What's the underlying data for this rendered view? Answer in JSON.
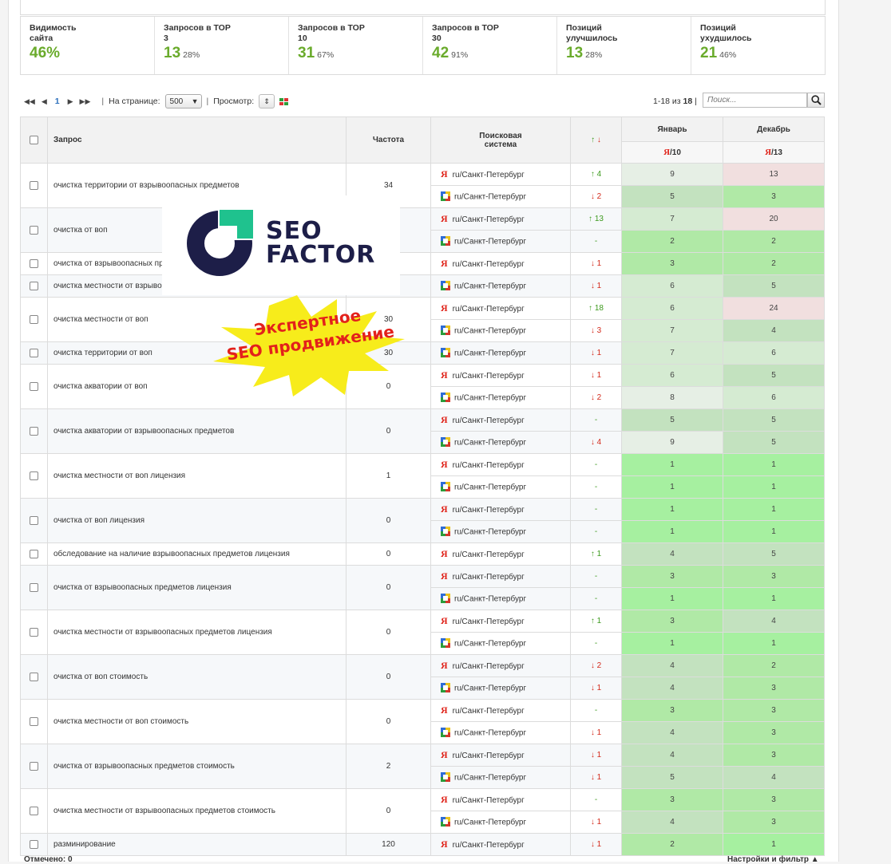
{
  "stats": [
    {
      "label": "Видимость сайта",
      "value": "46%",
      "pct": ""
    },
    {
      "label": "Запросов в TOP 3",
      "value": "13",
      "pct": "28%"
    },
    {
      "label": "Запросов в TOP 10",
      "value": "31",
      "pct": "67%"
    },
    {
      "label": "Запросов в TOP 30",
      "value": "42",
      "pct": "91%"
    },
    {
      "label": "Позиций улучшилось",
      "value": "13",
      "pct": "28%"
    },
    {
      "label": "Позиций ухудшилось",
      "value": "21",
      "pct": "46%"
    }
  ],
  "pager": {
    "first": "◀◀",
    "prev": "◀",
    "page": "1",
    "next": "▶",
    "last": "▶▶",
    "per_page_label": "На странице:",
    "per_page": "500",
    "view_label": "Просмотр:",
    "count_text": "1-18 из ",
    "count_total": "18",
    "search_placeholder": "Поиск..."
  },
  "table": {
    "headers": {
      "query": "Запрос",
      "freq": "Частота",
      "engine": "Поисковая система",
      "change": "↑↓",
      "jan": "Январь",
      "dec": "Декабрь",
      "jan_sub": "10",
      "dec_sub": "13"
    },
    "rows": [
      {
        "q": "очистка территории от взрывоопасных предметов",
        "f": "34",
        "e": [
          {
            "s": "y",
            "r": "ru/Санкт-Петербург",
            "c": "↑ 4",
            "ct": "up",
            "j": "9",
            "d": "13"
          },
          {
            "s": "g",
            "r": "ru/Санкт-Петербург",
            "c": "↓ 2",
            "ct": "dn",
            "j": "5",
            "d": "3"
          }
        ]
      },
      {
        "q": "очистка от воп",
        "f": "",
        "e": [
          {
            "s": "y",
            "r": "ru/Санкт-Петербург",
            "c": "↑ 13",
            "ct": "up",
            "j": "7",
            "d": "20"
          },
          {
            "s": "g",
            "r": "ru/Санкт-Петербург",
            "c": "-",
            "ct": "eq",
            "j": "2",
            "d": "2"
          }
        ]
      },
      {
        "q": "очистка от взрывоопасных пре",
        "f": "",
        "e": [
          {
            "s": "y",
            "r": "ru/Санкт-Петербург",
            "c": "↓ 1",
            "ct": "dn",
            "j": "3",
            "d": "2"
          }
        ]
      },
      {
        "q": "очистка местности от взрывоо",
        "f": "",
        "e": [
          {
            "s": "g",
            "r": "ru/Санкт-Петербург",
            "c": "↓ 1",
            "ct": "dn",
            "j": "6",
            "d": "5"
          }
        ]
      },
      {
        "q": "очистка местности от воп",
        "f": "30",
        "e": [
          {
            "s": "y",
            "r": "ru/Санкт-Петербург",
            "c": "↑ 18",
            "ct": "up",
            "j": "6",
            "d": "24"
          },
          {
            "s": "g",
            "r": "ru/Санкт-Петербург",
            "c": "↓ 3",
            "ct": "dn",
            "j": "7",
            "d": "4"
          }
        ]
      },
      {
        "q": "очистка территории от воп",
        "f": "30",
        "e": [
          {
            "s": "g",
            "r": "ru/Санкт-Петербург",
            "c": "↓ 1",
            "ct": "dn",
            "j": "7",
            "d": "6"
          }
        ]
      },
      {
        "q": "очистка акватории от воп",
        "f": "0",
        "e": [
          {
            "s": "y",
            "r": "ru/Санкт-Петербург",
            "c": "↓ 1",
            "ct": "dn",
            "j": "6",
            "d": "5"
          },
          {
            "s": "g",
            "r": "ru/Санкт-Петербург",
            "c": "↓ 2",
            "ct": "dn",
            "j": "8",
            "d": "6"
          }
        ]
      },
      {
        "q": "очистка акватории от взрывоопасных предметов",
        "f": "0",
        "e": [
          {
            "s": "y",
            "r": "ru/Санкт-Петербург",
            "c": "-",
            "ct": "eq",
            "j": "5",
            "d": "5"
          },
          {
            "s": "g",
            "r": "ru/Санкт-Петербург",
            "c": "↓ 4",
            "ct": "dn",
            "j": "9",
            "d": "5"
          }
        ]
      },
      {
        "q": "очистка местности от воп лицензия",
        "f": "1",
        "e": [
          {
            "s": "y",
            "r": "ru/Санкт-Петербург",
            "c": "-",
            "ct": "eq",
            "j": "1",
            "d": "1"
          },
          {
            "s": "g",
            "r": "ru/Санкт-Петербург",
            "c": "-",
            "ct": "eq",
            "j": "1",
            "d": "1"
          }
        ]
      },
      {
        "q": "очистка от воп лицензия",
        "f": "0",
        "e": [
          {
            "s": "y",
            "r": "ru/Санкт-Петербург",
            "c": "-",
            "ct": "eq",
            "j": "1",
            "d": "1"
          },
          {
            "s": "g",
            "r": "ru/Санкт-Петербург",
            "c": "-",
            "ct": "eq",
            "j": "1",
            "d": "1"
          }
        ]
      },
      {
        "q": "обследование на наличие взрывоопасных предметов лицензия",
        "f": "0",
        "e": [
          {
            "s": "y",
            "r": "ru/Санкт-Петербург",
            "c": "↑ 1",
            "ct": "up",
            "j": "4",
            "d": "5"
          }
        ]
      },
      {
        "q": "очистка от взрывоопасных предметов лицензия",
        "f": "0",
        "e": [
          {
            "s": "y",
            "r": "ru/Санкт-Петербург",
            "c": "-",
            "ct": "eq",
            "j": "3",
            "d": "3"
          },
          {
            "s": "g",
            "r": "ru/Санкт-Петербург",
            "c": "-",
            "ct": "eq",
            "j": "1",
            "d": "1"
          }
        ]
      },
      {
        "q": "очистка местности от взрывоопасных предметов лицензия",
        "f": "0",
        "e": [
          {
            "s": "y",
            "r": "ru/Санкт-Петербург",
            "c": "↑ 1",
            "ct": "up",
            "j": "3",
            "d": "4"
          },
          {
            "s": "g",
            "r": "ru/Санкт-Петербург",
            "c": "-",
            "ct": "eq",
            "j": "1",
            "d": "1"
          }
        ]
      },
      {
        "q": "очистка от воп стоимость",
        "f": "0",
        "e": [
          {
            "s": "y",
            "r": "ru/Санкт-Петербург",
            "c": "↓ 2",
            "ct": "dn",
            "j": "4",
            "d": "2"
          },
          {
            "s": "g",
            "r": "ru/Санкт-Петербург",
            "c": "↓ 1",
            "ct": "dn",
            "j": "4",
            "d": "3"
          }
        ]
      },
      {
        "q": "очистка местности от воп стоимость",
        "f": "0",
        "e": [
          {
            "s": "y",
            "r": "ru/Санкт-Петербург",
            "c": "-",
            "ct": "eq",
            "j": "3",
            "d": "3"
          },
          {
            "s": "g",
            "r": "ru/Санкт-Петербург",
            "c": "↓ 1",
            "ct": "dn",
            "j": "4",
            "d": "3"
          }
        ]
      },
      {
        "q": "очистка от взрывоопасных предметов стоимость",
        "f": "2",
        "e": [
          {
            "s": "y",
            "r": "ru/Санкт-Петербург",
            "c": "↓ 1",
            "ct": "dn",
            "j": "4",
            "d": "3"
          },
          {
            "s": "g",
            "r": "ru/Санкт-Петербург",
            "c": "↓ 1",
            "ct": "dn",
            "j": "5",
            "d": "4"
          }
        ]
      },
      {
        "q": "очистка местности от взрывоопасных предметов стоимость",
        "f": "0",
        "e": [
          {
            "s": "y",
            "r": "ru/Санкт-Петербург",
            "c": "-",
            "ct": "eq",
            "j": "3",
            "d": "3"
          },
          {
            "s": "g",
            "r": "ru/Санкт-Петербург",
            "c": "↓ 1",
            "ct": "dn",
            "j": "4",
            "d": "3"
          }
        ]
      },
      {
        "q": "разминирование",
        "f": "120",
        "e": [
          {
            "s": "y",
            "r": "ru/Санкт-Петербург",
            "c": "↓ 1",
            "ct": "dn",
            "j": "2",
            "d": "1"
          }
        ]
      }
    ]
  },
  "footer": {
    "marked": "Отмечено: 0",
    "settings": "Настройки и фильтр ▲"
  },
  "overlay": {
    "logo_line1": "SEO",
    "logo_line2": "FACTOR",
    "burst_line1": "Экспертное",
    "burst_line2": "SEO продвижение"
  },
  "colors": {
    "accent": "#6aab2c",
    "yandex": "#e0261d",
    "up": "#3d9a1e",
    "down": "#d32a1c"
  }
}
